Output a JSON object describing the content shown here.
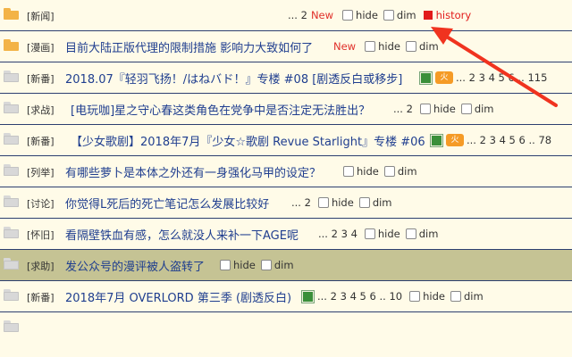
{
  "labels": {
    "hide": "hide",
    "dim": "dim",
    "history": "history",
    "new": "New"
  },
  "rows": [
    {
      "tag": "[新闻]",
      "title": "",
      "pages": "... 2",
      "new": true,
      "history": true,
      "folder": "orange"
    },
    {
      "tag": "[漫画]",
      "title": "目前大陆正版代理的限制措施 影响力大致如何了",
      "pages": "",
      "new": true,
      "folder": "orange"
    },
    {
      "tag": "[新番]",
      "title": "2018.07『轻羽飞扬！/はねバド！』专楼 #08 [剧透反白或移步]",
      "pages": "... 2 3 4 5 6 .. 115",
      "pic": true,
      "fire": true,
      "folder": "gray"
    },
    {
      "tag": "[求战]",
      "title": "[电玩咖]星之守心春这类角色在党争中是否注定无法胜出？",
      "pages": "... 2",
      "folder": "gray"
    },
    {
      "tag": "[新番]",
      "title": "【少女歌剧】2018年7月『少女☆歌剧 Revue Starlight』专楼 #06",
      "pages": "... 2 3 4 5 6 .. 78",
      "pic": true,
      "fire": true,
      "folder": "gray"
    },
    {
      "tag": "[列举]",
      "title": "有哪些萝卜是本体之外还有一身强化马甲的设定？",
      "pages": "",
      "folder": "gray"
    },
    {
      "tag": "[讨论]",
      "title": "你觉得L死后的死亡笔记怎么发展比较好",
      "pages": "... 2",
      "folder": "gray"
    },
    {
      "tag": "[怀旧]",
      "title": "看隔壁铁血有感，怎么就没人来补一下AGE呢",
      "pages": "... 2 3 4",
      "folder": "gray"
    },
    {
      "tag": "[求助]",
      "title": "发公众号的漫评被人盗转了",
      "pages": "",
      "folder": "gray",
      "highlight": true
    },
    {
      "tag": "[新番]",
      "title": "2018年7月 OVERLORD 第三季 (剧透反白)",
      "pages": "... 2 3 4 5 6 .. 10",
      "pic": true,
      "folder": "gray"
    }
  ]
}
